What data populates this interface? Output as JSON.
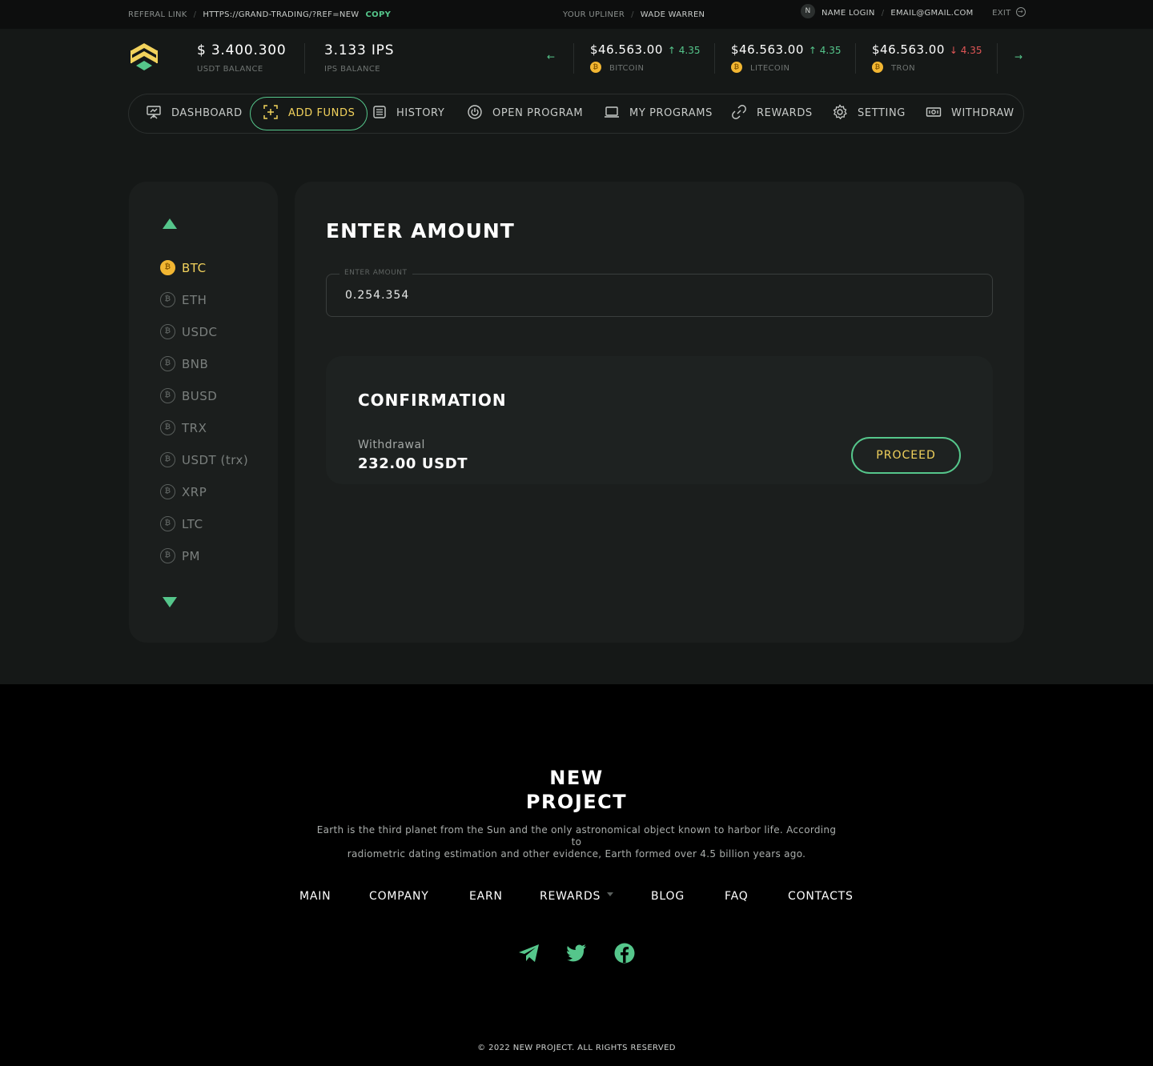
{
  "topbar": {
    "referral_label": "REFERAL LINK",
    "referral_url": "HTTPS://GRAND-TRADING/?REF=NEW",
    "copy_label": "COPY",
    "upliner_label": "YOUR UPLINER",
    "upliner_name": "WADE WARREN",
    "avatar_initial": "N",
    "name_login": "NAME LOGIN",
    "email": "EMAIL@GMAIL.COM",
    "exit_label": "EXIT"
  },
  "header": {
    "usdt_balance": "$ 3.400.300",
    "usdt_balance_label": "USDT BALANCE",
    "ips_balance": "3.133 IPS",
    "ips_balance_label": "IPS BALANCE",
    "tickers": [
      {
        "price": "$46.563.00",
        "arrow": "↑",
        "change": "4.35",
        "direction": "up",
        "coin": "BITCOIN"
      },
      {
        "price": "$46.563.00",
        "arrow": "↑",
        "change": "4.35",
        "direction": "up",
        "coin": "LITECOIN"
      },
      {
        "price": "$46.563.00",
        "arrow": "↓",
        "change": "4.35",
        "direction": "down",
        "coin": "TRON"
      }
    ]
  },
  "nav": {
    "items": [
      {
        "label": "DASHBOARD",
        "icon": "presentation-icon"
      },
      {
        "label": "ADD FUNDS",
        "icon": "add-square-icon",
        "active": true
      },
      {
        "label": "HISTORY",
        "icon": "list-icon"
      },
      {
        "label": "OPEN PROGRAM",
        "icon": "power-icon"
      },
      {
        "label": "MY PROGRAMS",
        "icon": "laptop-icon"
      },
      {
        "label": "REWARDS",
        "icon": "link-icon"
      },
      {
        "label": "SETTING",
        "icon": "gear-icon"
      },
      {
        "label": "WITHDRAW",
        "icon": "cash-icon"
      }
    ]
  },
  "coins": {
    "items": [
      "BTC",
      "ETH",
      "USDC",
      "BNB",
      "BUSD",
      "TRX",
      "USDT (trx)",
      "XRP",
      "LTC",
      "PM"
    ],
    "selected": "BTC"
  },
  "main": {
    "title": "ENTER AMOUNT",
    "amount_label": "ENTER AMOUNT",
    "amount_value": "0.254.354",
    "confirmation": {
      "title": "CONFIRMATION",
      "withdrawal_label": "Withdrawal",
      "withdrawal_value": "232.00 USDT",
      "proceed_label": "PROCEED"
    }
  },
  "footer": {
    "title_line1": "NEW",
    "title_line2": "PROJECT",
    "description_line1": "Earth is the third planet from the Sun and the only astronomical object known to harbor life. According to",
    "description_line2": "radiometric dating estimation and other evidence, Earth formed over 4.5 billion years ago.",
    "links": [
      "MAIN",
      "COMPANY",
      "EARN",
      "REWARDS",
      "BLOG",
      "FAQ",
      "CONTACTS"
    ],
    "social": [
      "telegram-icon",
      "twitter-icon",
      "facebook-icon"
    ],
    "copyright": "© 2022 NEW PROJECT. ALL RIGHTS RESERVED"
  },
  "colors": {
    "accent_green": "#55c68b",
    "accent_yellow": "#f2d25c",
    "down_red": "#e05656",
    "coin_gold": "#f2b632"
  }
}
